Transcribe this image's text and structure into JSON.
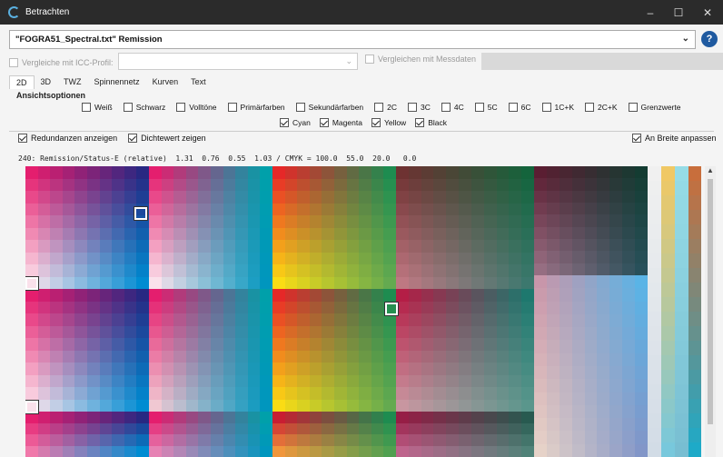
{
  "window": {
    "title": "Betrachten"
  },
  "file": {
    "selected": "\"FOGRA51_Spectral.txt\" Remission"
  },
  "compare": {
    "icc_label": "Vergleiche mit ICC-Profil:",
    "icc_value": "",
    "measure_label": "Vergleichen mit Messdaten"
  },
  "tabs": [
    "2D",
    "3D",
    "TWZ",
    "Spinnennetz",
    "Kurven",
    "Text"
  ],
  "options": {
    "title": "Ansichtsoptionen",
    "row1": [
      {
        "label": "Weiß",
        "checked": false
      },
      {
        "label": "Schwarz",
        "checked": false
      },
      {
        "label": "Volltöne",
        "checked": false
      },
      {
        "label": "Primärfarben",
        "checked": false
      },
      {
        "label": "Sekundärfarben",
        "checked": false
      },
      {
        "label": "2C",
        "checked": false
      },
      {
        "label": "3C",
        "checked": false
      },
      {
        "label": "4C",
        "checked": false
      },
      {
        "label": "5C",
        "checked": false
      },
      {
        "label": "6C",
        "checked": false
      },
      {
        "label": "1C+K",
        "checked": false
      },
      {
        "label": "2C+K",
        "checked": false
      },
      {
        "label": "Grenzwerte",
        "checked": false
      }
    ],
    "row2": [
      {
        "label": "Cyan",
        "checked": true
      },
      {
        "label": "Magenta",
        "checked": true
      },
      {
        "label": "Yellow",
        "checked": true
      },
      {
        "label": "Black",
        "checked": true
      }
    ]
  },
  "display": {
    "redundancies": "Redundanzen anzeigen",
    "density": "Dichtewert zeigen",
    "fit_width": "An Breite anpassen"
  },
  "status_line": "240: Remission/Status-E (relative)  1.31  0.76  0.55  1.03 / CMYK = 100.0  55.0  20.0   0.0"
}
